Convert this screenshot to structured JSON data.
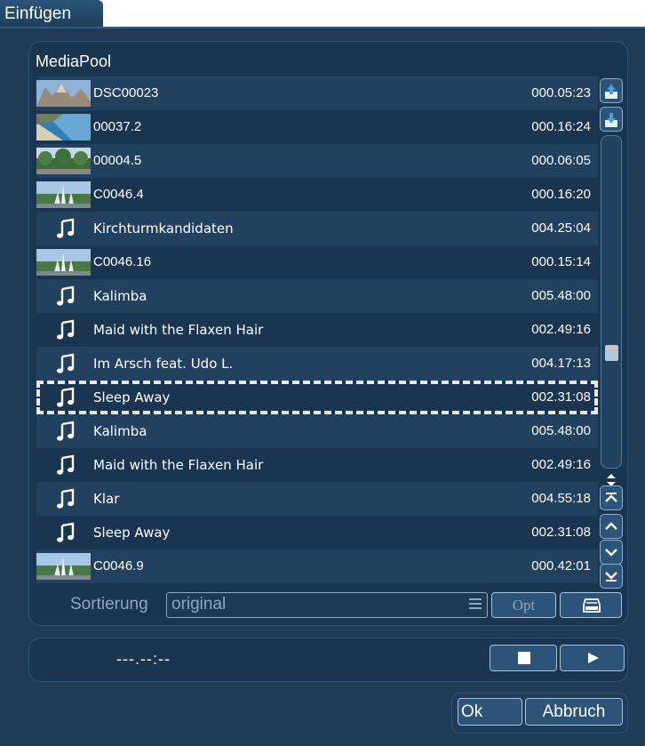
{
  "window": {
    "title": "Einfügen"
  },
  "mediapool": {
    "title": "MediaPool",
    "items": [
      {
        "type": "video",
        "thumb": "mountain",
        "name": "DSC00023",
        "duration": "000.05:23"
      },
      {
        "type": "video",
        "thumb": "beach",
        "name": "00037.2",
        "duration": "000.16:24"
      },
      {
        "type": "video",
        "thumb": "trees",
        "name": "00004.5",
        "duration": "000.06:05"
      },
      {
        "type": "video",
        "thumb": "fountain",
        "name": "C0046.4",
        "duration": "000.16:20"
      },
      {
        "type": "music",
        "name": "Kirchturmkandidaten",
        "duration": "004.25:04"
      },
      {
        "type": "video",
        "thumb": "fountain",
        "name": "C0046.16",
        "duration": "000.15:14"
      },
      {
        "type": "music",
        "name": "Kalimba",
        "duration": "005.48:00"
      },
      {
        "type": "music",
        "name": "Maid with the Flaxen Hair",
        "duration": "002.49:16"
      },
      {
        "type": "music",
        "name": "Im Arsch feat. Udo L.",
        "duration": "004.17:13"
      },
      {
        "type": "music",
        "name": "Sleep Away",
        "duration": "002.31:08",
        "selected": true
      },
      {
        "type": "music",
        "name": "Kalimba",
        "duration": "005.48:00"
      },
      {
        "type": "music",
        "name": "Maid with the Flaxen Hair",
        "duration": "002.49:16"
      },
      {
        "type": "music",
        "name": "Klar",
        "duration": "004.55:18"
      },
      {
        "type": "music",
        "name": "Sleep Away",
        "duration": "002.31:08"
      },
      {
        "type": "video",
        "thumb": "fountain",
        "name": "C0046.9",
        "duration": "000.42:01"
      }
    ]
  },
  "sort": {
    "label": "Sortierung",
    "value": "original",
    "options_label": "Opt"
  },
  "player": {
    "timecode": "---.--:--"
  },
  "buttons": {
    "ok": "Ok",
    "cancel": "Abbruch"
  },
  "colors": {
    "panel": "#1a3550",
    "row_alt": "#21415f",
    "accent": "#2c5478"
  }
}
